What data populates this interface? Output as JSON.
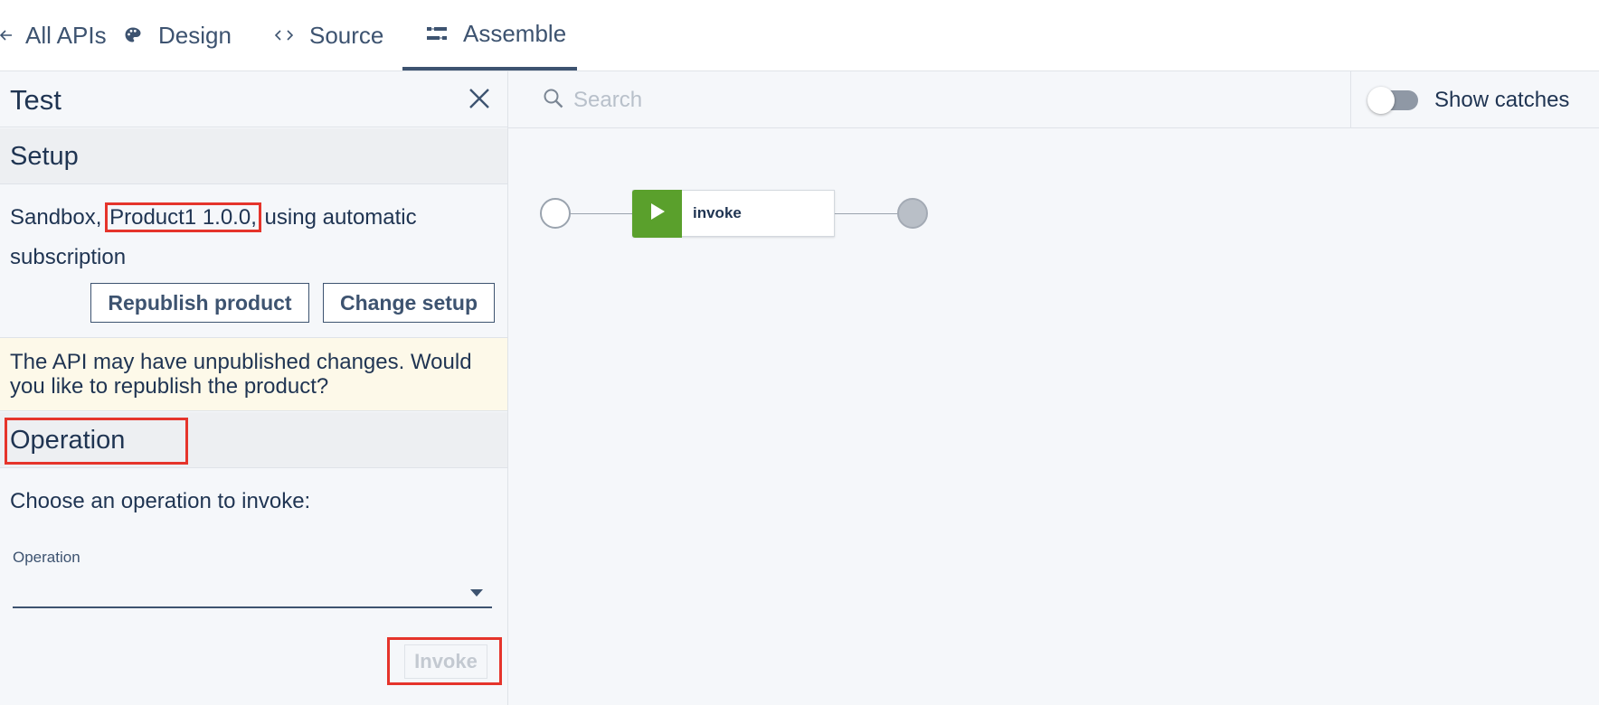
{
  "nav": {
    "back_label": "All APIs",
    "design_label": "Design",
    "source_label": "Source",
    "assemble_label": "Assemble",
    "active_tab": "Assemble"
  },
  "test_panel": {
    "title": "Test",
    "setup": {
      "heading": "Setup",
      "prefix": "Sandbox,",
      "product": "Product1 1.0.0,",
      "suffix": "using automatic subscription",
      "republish_label": "Republish product",
      "change_setup_label": "Change setup"
    },
    "warning": "The API may have unpublished changes. Would you like to republish the product?",
    "operation": {
      "heading": "Operation",
      "prompt": "Choose an operation to invoke:",
      "field_label": "Operation",
      "selected_value": "",
      "invoke_label": "Invoke",
      "invoke_disabled": true
    }
  },
  "canvas": {
    "search_placeholder": "Search",
    "show_catches_label": "Show catches",
    "show_catches_on": false,
    "policy_label": "invoke",
    "policy_color": "#5aa02c"
  },
  "icons": {
    "back": "arrow-left-icon",
    "design": "palette-icon",
    "source": "code-brackets-icon",
    "assemble": "assemble-flow-icon",
    "close": "close-icon",
    "search": "search-icon",
    "caret": "chevron-down-icon",
    "play": "play-icon"
  }
}
